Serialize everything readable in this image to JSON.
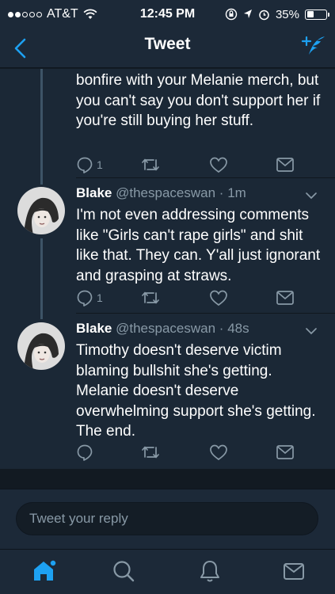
{
  "status_bar": {
    "carrier": "AT&T",
    "time": "12:45 PM",
    "battery": "35%",
    "battery_level": 0.35
  },
  "nav": {
    "title": "Tweet",
    "back_icon": "chevron-left-icon",
    "compose_icon": "compose-tweet-icon"
  },
  "tweets": [
    {
      "text": "bonfire with your Melanie merch, but you can't say you don't support her if you're still buying her stuff.",
      "reply_count": "1"
    },
    {
      "name": "Blake",
      "handle": "@thespaceswan",
      "sep": "·",
      "ago": "1m",
      "text": "I'm not even addressing comments like \"Girls can't rape girls\" and shit like that. They can. Y'all just ignorant and grasping at straws.",
      "reply_count": "1"
    },
    {
      "name": "Blake",
      "handle": "@thespaceswan",
      "sep": "·",
      "ago": "48s",
      "text": "Timothy doesn't deserve victim blaming bullshit she's getting. Melanie doesn't deserve overwhelming support she's getting. The end.",
      "reply_count": ""
    }
  ],
  "reply": {
    "placeholder": "Tweet your reply"
  },
  "tabs": [
    "home-icon",
    "search-icon",
    "notifications-icon",
    "messages-icon"
  ],
  "colors": {
    "accent": "#1da1f2",
    "background": "#1b2836",
    "bar": "#1c2938",
    "muted": "#8899a6"
  }
}
